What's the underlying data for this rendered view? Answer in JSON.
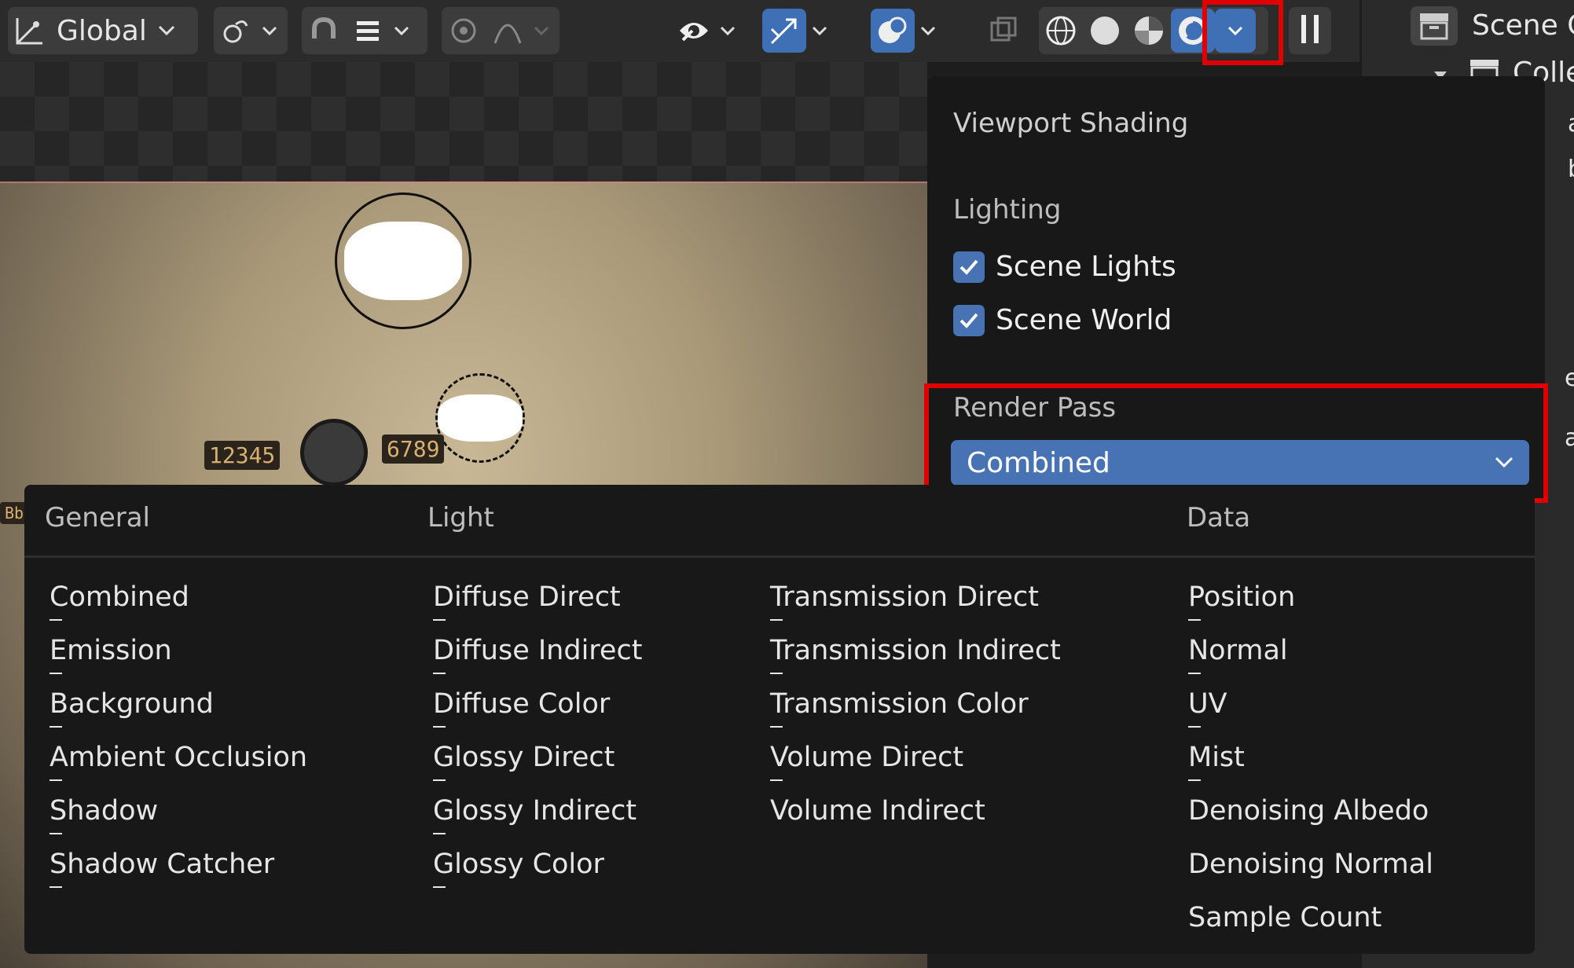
{
  "header": {
    "transform_orientation": "Global",
    "icons": [
      "transform-pivot-icon",
      "snap-link-icon",
      "snap-magnet-icon",
      "snap-increment-icon",
      "proportional-edit-icon",
      "falloff-curve-icon",
      "visibility-eye-icon",
      "gizmo-arrow-icon",
      "overlay-icon",
      "xray-icon",
      "wireframe-shading-icon",
      "solid-shading-icon",
      "material-preview-icon",
      "rendered-shading-icon",
      "chevron-down-icon",
      "pause-icon"
    ]
  },
  "outliner": {
    "rows": [
      "Scene Co",
      "Colle",
      "a",
      "b",
      "es",
      "at"
    ]
  },
  "viewport": {
    "signs": [
      "12345",
      "6789"
    ],
    "corner_label": "Bb"
  },
  "popover": {
    "title": "Viewport Shading",
    "lighting_label": "Lighting",
    "scene_lights": "Scene Lights",
    "scene_world": "Scene World",
    "render_pass_label": "Render Pass",
    "render_pass_value": "Combined"
  },
  "menu": {
    "headers": {
      "general": "General",
      "light": "Light",
      "data": "Data"
    },
    "general": [
      "Combined",
      "Emission",
      "Background",
      "Ambient Occlusion",
      "Shadow",
      "Shadow Catcher"
    ],
    "light_col1": [
      "Diffuse Direct",
      "Diffuse Indirect",
      "Diffuse Color",
      "Glossy Direct",
      "Glossy Indirect",
      "Glossy Color"
    ],
    "light_col2": [
      "Transmission Direct",
      "Transmission Indirect",
      "Transmission Color",
      "Volume Direct",
      "Volume Indirect"
    ],
    "data": [
      "Position",
      "Normal",
      "UV",
      "Mist",
      "Denoising Albedo",
      "Denoising Normal",
      "Sample Count"
    ]
  },
  "colors": {
    "accent": "#4772b3",
    "highlight": "#e00000",
    "menu_bg": "#181818"
  }
}
